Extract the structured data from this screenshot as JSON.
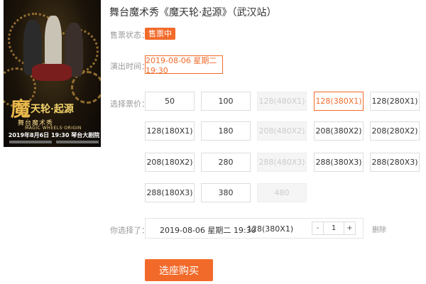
{
  "title": "舞台魔术秀《魔天轮·起源》（武汉站）",
  "poster": {
    "title_big": "魔",
    "title_rest": "天轮·起源",
    "subtitle": "舞台魔术秀",
    "english": "MAGIC WHEELS·ORIGIN",
    "date_venue": "2019年8月6日 19:30  琴台大剧院"
  },
  "status": {
    "label": "售票状态：",
    "value": "售票中"
  },
  "showtime": {
    "label": "演出时间：",
    "value": "2019-08-06 星期二 19:30"
  },
  "prices": {
    "label": "选择票价：",
    "options": [
      {
        "text": "50",
        "state": "normal"
      },
      {
        "text": "100",
        "state": "normal"
      },
      {
        "text": "128(480X1)",
        "state": "disabled"
      },
      {
        "text": "128(380X1)",
        "state": "selected"
      },
      {
        "text": "128(280X1)",
        "state": "normal"
      },
      {
        "text": "128(180X1)",
        "state": "normal"
      },
      {
        "text": "180",
        "state": "normal"
      },
      {
        "text": "208(480X2)",
        "state": "disabled"
      },
      {
        "text": "208(380X2)",
        "state": "normal"
      },
      {
        "text": "208(280X2)",
        "state": "normal"
      },
      {
        "text": "208(180X2)",
        "state": "normal"
      },
      {
        "text": "280",
        "state": "normal"
      },
      {
        "text": "288(480X3)",
        "state": "disabled"
      },
      {
        "text": "288(380X3)",
        "state": "normal"
      },
      {
        "text": "288(280X3)",
        "state": "normal"
      },
      {
        "text": "288(180X3)",
        "state": "normal"
      },
      {
        "text": "380",
        "state": "normal"
      },
      {
        "text": "480",
        "state": "disabled"
      }
    ]
  },
  "selection": {
    "label": "你选择了：",
    "time": "2019-08-06 星期二 19:30",
    "price": "128(380X1)",
    "minus": "-",
    "quantity": "1",
    "plus": "+",
    "delete": "删除"
  },
  "buy_button": "选座购买",
  "colors": {
    "accent": "#f26a2a"
  }
}
